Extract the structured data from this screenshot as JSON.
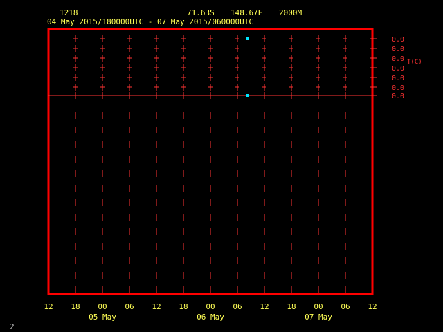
{
  "header": {
    "station_id": "1218",
    "lat": "71.63S",
    "lon": "148.67E",
    "altitude": "2000M",
    "time_range": "04 May 2015/180000UTC - 07 May 2015/060000UTC"
  },
  "colors": {
    "frame": "#ff0000",
    "grid": "#ff3333",
    "text": "#ffff55",
    "marker": "#00e5ff",
    "background": "#000000"
  },
  "chart_data": {
    "type": "line",
    "variable": "T(C)",
    "x_ticks": [
      "12",
      "18",
      "00",
      "06",
      "12",
      "18",
      "00",
      "06",
      "12",
      "18",
      "00",
      "06",
      "12"
    ],
    "date_labels": [
      "05 May",
      "06 May",
      "07 May"
    ],
    "y_value_labels": [
      "0.0",
      "0.0",
      "0.0",
      "0.0",
      "0.0",
      "0.0",
      "0.0"
    ],
    "series": [
      {
        "values": [
          0.0,
          0.0,
          0.0,
          0.0,
          0.0,
          0.0,
          0.0
        ]
      }
    ]
  },
  "footer": {
    "page_number": "2"
  }
}
